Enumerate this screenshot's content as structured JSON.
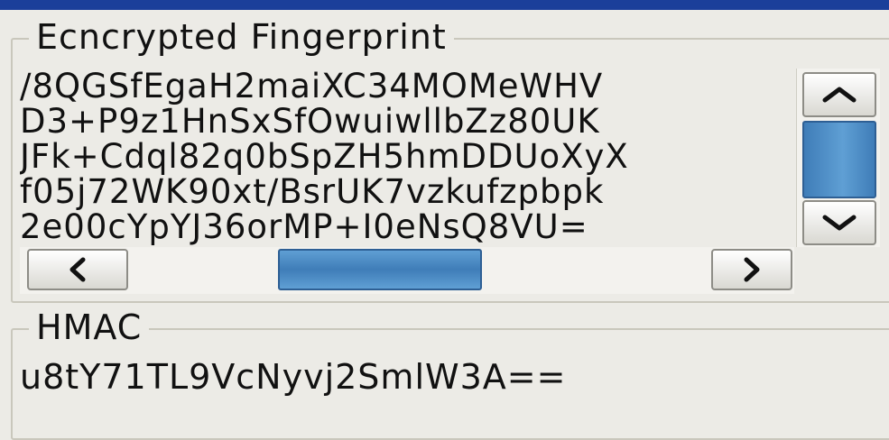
{
  "fingerprint": {
    "legend": "Ecncrypted Fingerprint",
    "lines": [
      "/8QGSfEgaH2maiXC34MOMeWHV",
      "D3+P9z1HnSxSfOwuiwllbZz80UK",
      "JFk+Cdql82q0bSpZH5hmDDUoXyX",
      "f05j72WK90xt/BsrUK7vzkufzpbpk",
      "2e00cYpYJ36orMP+I0eNsQ8VU="
    ],
    "scroll": {
      "vertical_position": 0.5,
      "horizontal_position": 0.45
    }
  },
  "hmac": {
    "legend": "HMAC",
    "value": "u8tY71TL9VcNyvj2SmlW3A=="
  },
  "icons": {
    "up": "chevron-up-icon",
    "down": "chevron-down-icon",
    "left": "chevron-left-icon",
    "right": "chevron-right-icon"
  },
  "colors": {
    "title_bar": "#1b3f9a",
    "scroll_thumb": "#4f8fc8",
    "background": "#ecebe6"
  }
}
